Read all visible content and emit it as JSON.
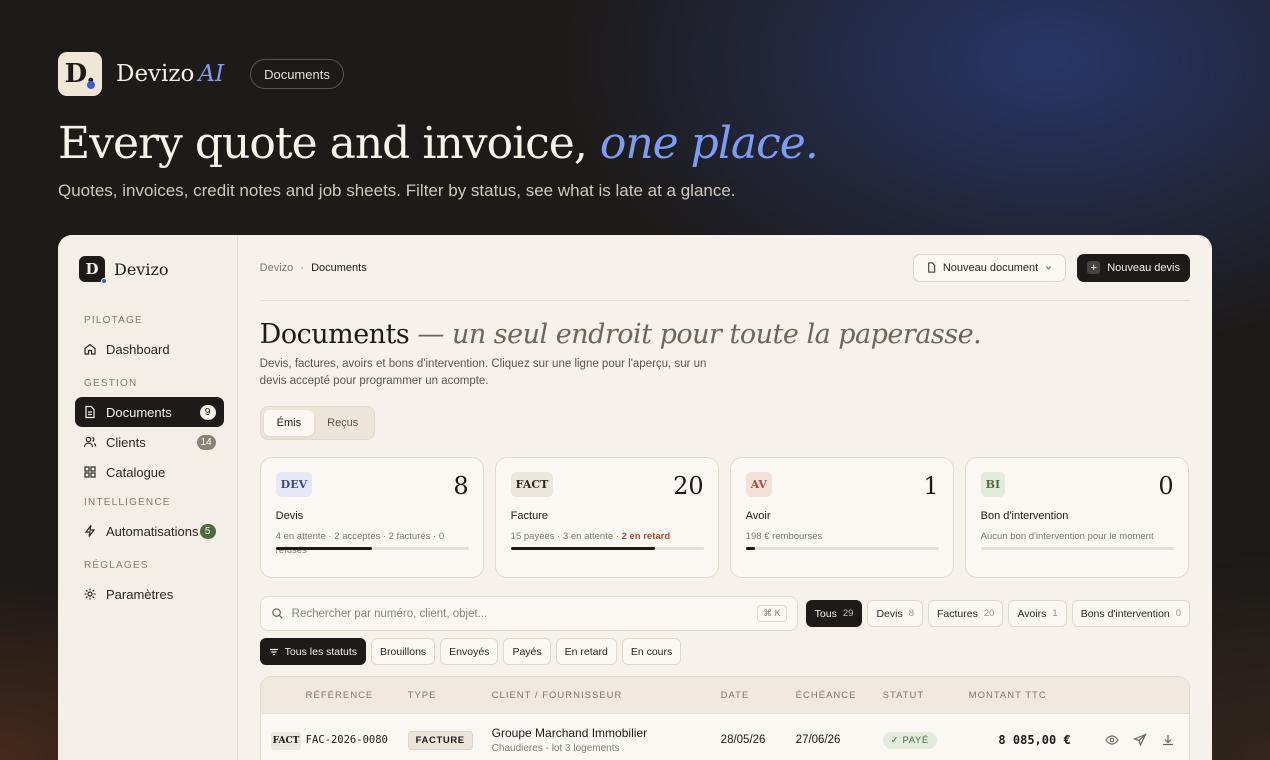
{
  "brand": {
    "logo_letter": "D.",
    "name": "Devizo",
    "ai": "AI",
    "pill": "Documents"
  },
  "hero": {
    "title_main": "Every quote and invoice,",
    "title_accent": "one place.",
    "subtitle": "Quotes, invoices, credit notes and job sheets. Filter by status, see what is late at a glance."
  },
  "app": {
    "logo_letter": "D",
    "name": "Devizo",
    "sidebar": {
      "sections": [
        {
          "title": "PILOTAGE",
          "items": [
            {
              "label": "Dashboard",
              "icon": "home-icon"
            }
          ]
        },
        {
          "title": "GESTION",
          "items": [
            {
              "label": "Documents",
              "icon": "document-icon",
              "badge": "9"
            },
            {
              "label": "Clients",
              "icon": "users-icon",
              "badge": "14"
            },
            {
              "label": "Catalogue",
              "icon": "grid-icon"
            }
          ]
        },
        {
          "title": "INTELLIGENCE",
          "items": [
            {
              "label": "Automatisations",
              "icon": "lightning-icon",
              "badge": "5"
            }
          ]
        },
        {
          "title": "RÉGLAGES",
          "items": [
            {
              "label": "Paramètres",
              "icon": "gear-icon"
            }
          ]
        }
      ]
    },
    "breadcrumb": {
      "root": "Devizo",
      "sep": "·",
      "current": "Documents"
    },
    "actions": {
      "new_document": "Nouveau document",
      "new_quote": "Nouveau devis"
    },
    "page": {
      "title": "Documents",
      "tagline": "— un seul endroit pour toute la paperasse.",
      "description": "Devis, factures, avoirs et bons d'intervention. Cliquez sur une ligne pour l'aperçu, sur un devis accepté pour programmer un acompte."
    },
    "segments": {
      "issued": "Émis",
      "received": "Reçus"
    },
    "cards": [
      {
        "chip": "DEV",
        "count": "8",
        "title": "Devis",
        "meta": "4 en attente · 2 acceptés · 2 facturés · 0 refusés",
        "progress": 0.5
      },
      {
        "chip": "FACT",
        "count": "20",
        "title": "Facture",
        "meta": "15 payées · 3 en attente · ",
        "late": "2 en retard",
        "progress": 0.75
      },
      {
        "chip": "AV",
        "count": "1",
        "title": "Avoir",
        "meta": "198 € remboursés",
        "progress": 0.05
      },
      {
        "chip": "BI",
        "count": "0",
        "title": "Bon d'intervention",
        "meta": "Aucun bon d'intervention pour le moment",
        "progress": 0
      }
    ],
    "search": {
      "placeholder": "Rechercher par numéro, client, objet...",
      "shortcut": "⌘ K"
    },
    "type_filters": [
      {
        "label": "Tous",
        "count": "29"
      },
      {
        "label": "Devis",
        "count": "8"
      },
      {
        "label": "Factures",
        "count": "20"
      },
      {
        "label": "Avoirs",
        "count": "1"
      },
      {
        "label": "Bons d'intervention",
        "count": "0"
      }
    ],
    "status_filters": [
      "Tous les statuts",
      "Brouillons",
      "Envoyés",
      "Payés",
      "En retard",
      "En cours"
    ],
    "table": {
      "headers": [
        "RÉFÉRENCE",
        "TYPE",
        "CLIENT / FOURNISSEUR",
        "DATE",
        "ÉCHÉANCE",
        "STATUT",
        "MONTANT TTC"
      ],
      "rows": [
        {
          "chip": "FACT",
          "reference": "FAC-2026-0080",
          "type": "FACTURE",
          "client": "Groupe Marchand Immobilier",
          "subject": "Chaudieres - lot 3 logements",
          "date": "28/05/26",
          "due": "27/06/26",
          "status": "✓ PAYÉ",
          "amount": "8 085,00 €"
        }
      ]
    }
  }
}
